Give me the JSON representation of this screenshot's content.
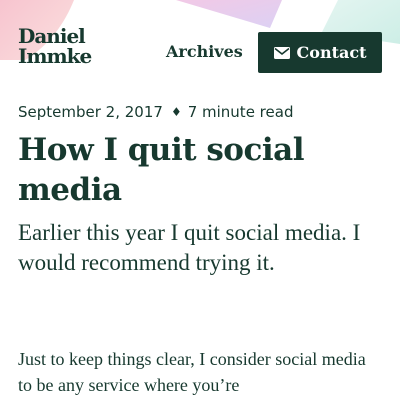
{
  "header": {
    "logo": {
      "line1": "Daniel",
      "line2": "Immke"
    },
    "nav": {
      "archives_label": "Archives",
      "contact_label": "Contact",
      "contact_icon": "envelope-icon"
    }
  },
  "colors": {
    "text": "#17392f",
    "button_bg": "#17392f",
    "button_text": "#ffffff",
    "decor_pink": "#f6c8d3",
    "decor_purple": "#e7cdef",
    "decor_teal": "#d8f0ea"
  },
  "post": {
    "date": "September 2, 2017",
    "separator": "♦",
    "read_time": "7 minute read",
    "title": "How I quit social media",
    "lede": "Earlier this year I quit social media. I would recommend trying it.",
    "body_start": "Just to keep things clear, I consider social media to be any service where you’re"
  }
}
